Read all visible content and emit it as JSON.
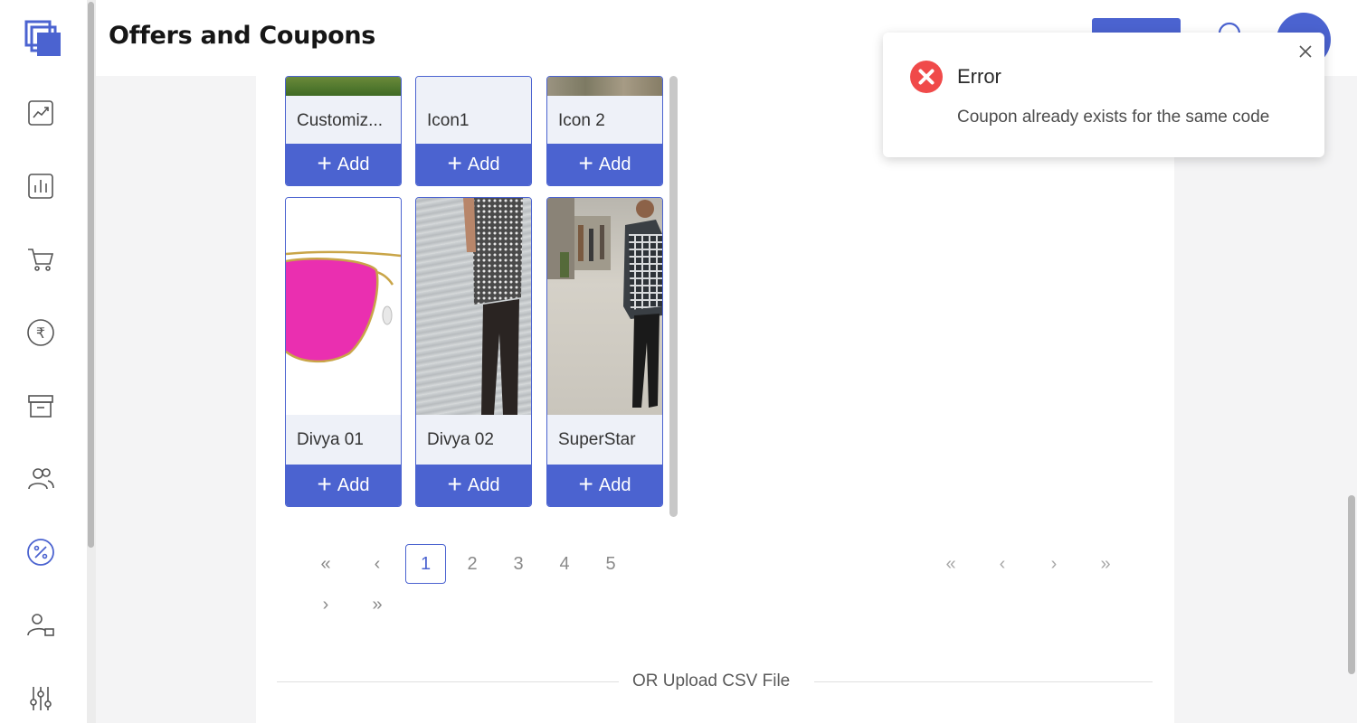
{
  "header": {
    "title": "Offers and Coupons",
    "action_button": "",
    "avatar_initials": "",
    "search_icon": "search-icon"
  },
  "sidebar": {
    "items": [
      {
        "name": "analytics",
        "icon": "trend-chart-icon"
      },
      {
        "name": "reports",
        "icon": "bar-chart-icon"
      },
      {
        "name": "orders",
        "icon": "cart-icon"
      },
      {
        "name": "payments",
        "icon": "rupee-icon"
      },
      {
        "name": "inventory",
        "icon": "archive-icon"
      },
      {
        "name": "customers",
        "icon": "users-icon"
      },
      {
        "name": "offers",
        "icon": "percent-icon",
        "active": true
      },
      {
        "name": "staff",
        "icon": "user-card-icon"
      },
      {
        "name": "settings",
        "icon": "sliders-icon"
      }
    ]
  },
  "products": [
    {
      "name": "Customiz...",
      "add_label": "Add"
    },
    {
      "name": "Icon1",
      "add_label": "Add"
    },
    {
      "name": "Icon 2",
      "add_label": "Add"
    },
    {
      "name": "Divya 01",
      "add_label": "Add"
    },
    {
      "name": "Divya 02",
      "add_label": "Add"
    },
    {
      "name": "SuperStar",
      "add_label": "Add"
    }
  ],
  "pagination": {
    "first": "«",
    "prev": "‹",
    "pages": [
      "1",
      "2",
      "3",
      "4",
      "5"
    ],
    "current": "1",
    "next": "›",
    "last": "»"
  },
  "upload": {
    "divider_text": "OR Upload CSV File"
  },
  "toast": {
    "title": "Error",
    "message": "Coupon already exists for the same code",
    "status_color": "#f04a4a"
  },
  "colors": {
    "accent": "#4b63d0"
  }
}
